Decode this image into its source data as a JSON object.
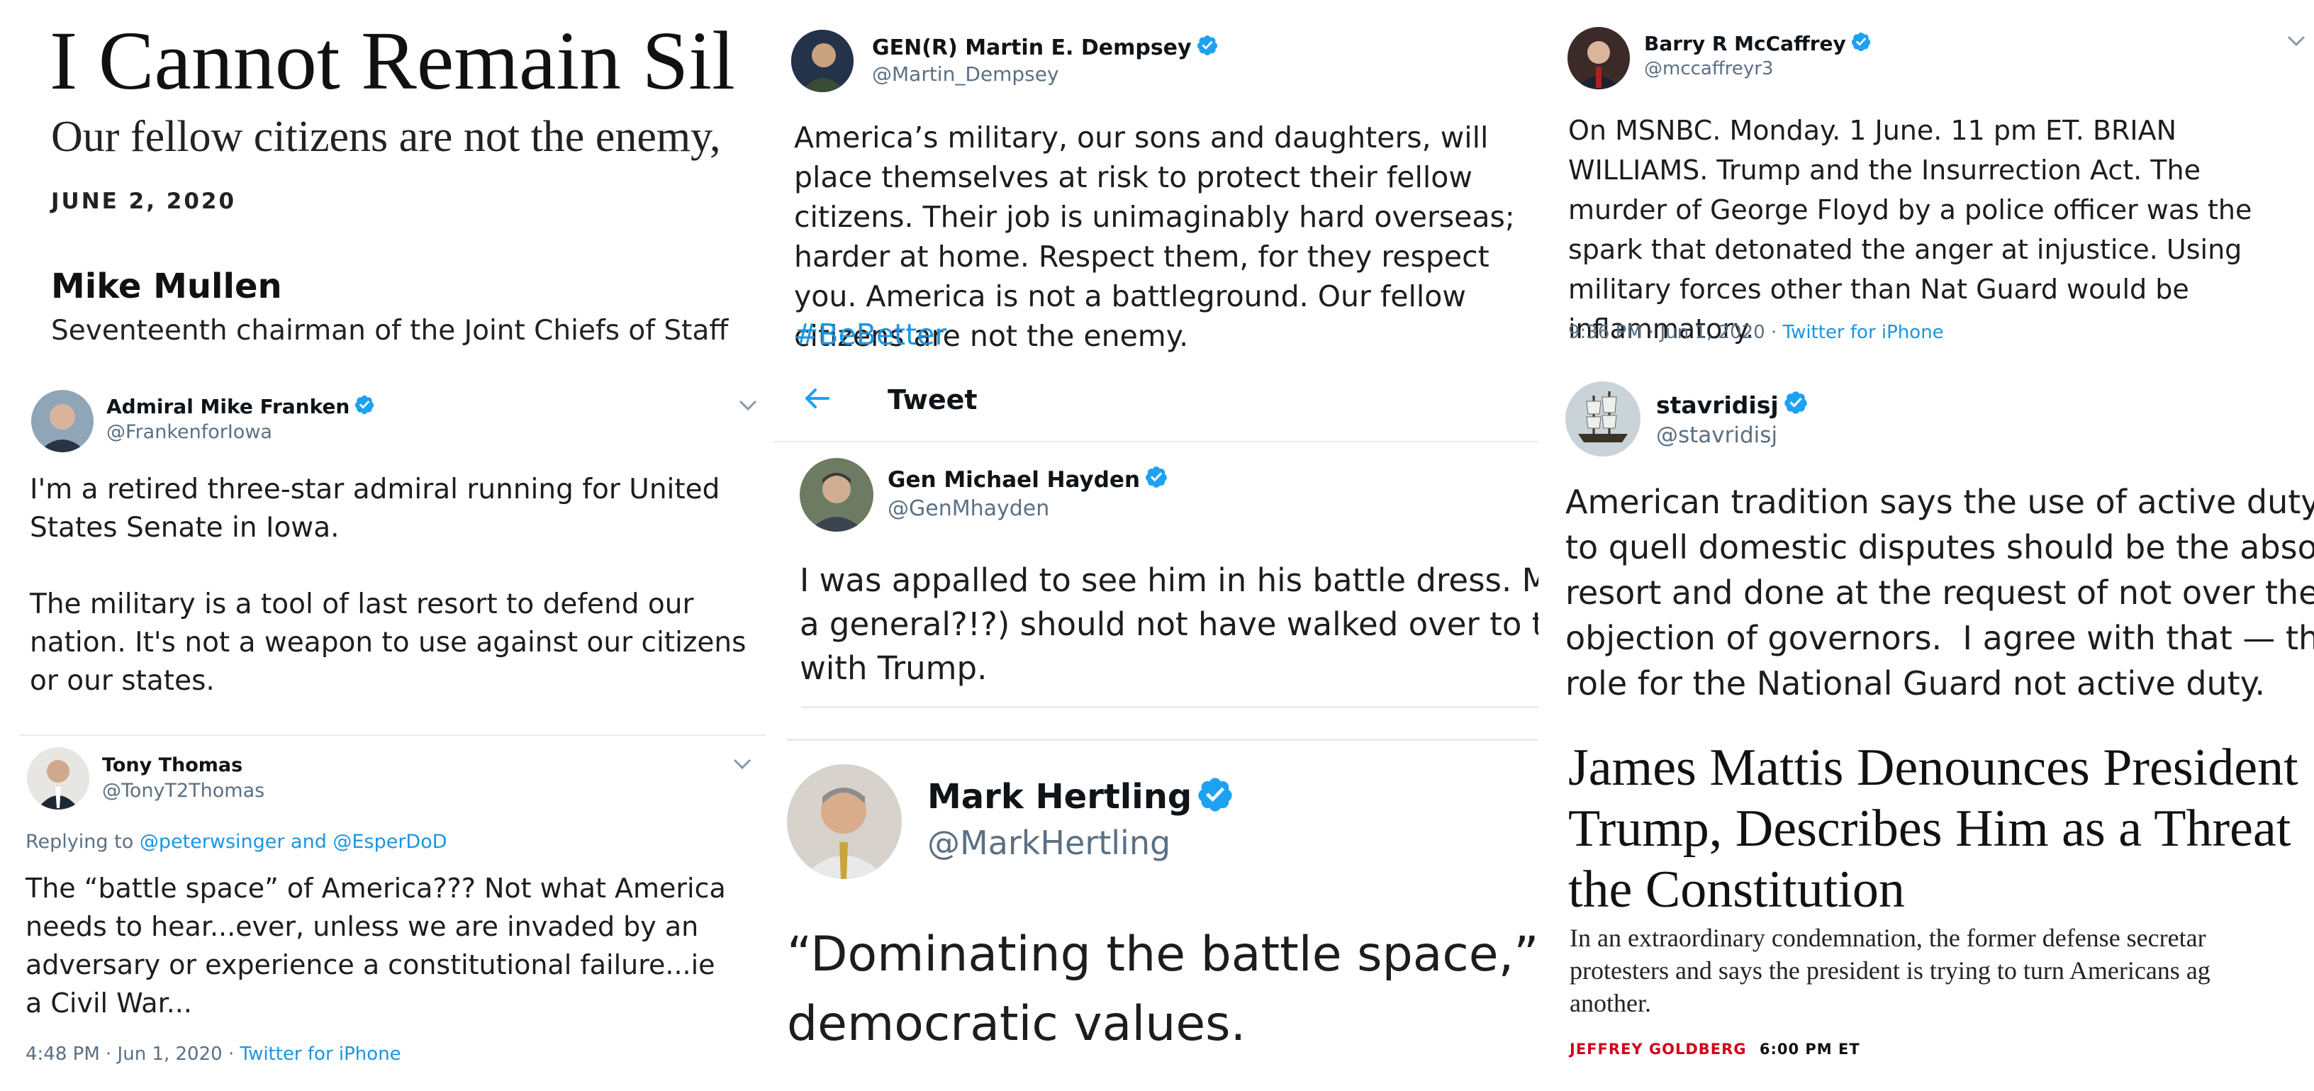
{
  "mullen": {
    "headline": "I Cannot Remain Sil",
    "subhead": "Our fellow citizens are not the enemy,",
    "date": "JUNE 2, 2020",
    "author": "Mike Mullen",
    "author_title": "Seventeenth chairman of the Joint Chiefs of Staff"
  },
  "dempsey": {
    "name": "GEN(R) Martin E. Dempsey",
    "handle": "@Martin_Dempsey",
    "text": "America’s military, our sons and daughters, will place themselves at risk to protect their fellow citizens. Their job is unimaginably hard overseas; harder at home. Respect them, for they respect you. America is not a battleground. Our fellow citizens are not the enemy.",
    "hashtag": "#BeBetter"
  },
  "mccaffrey": {
    "name": "Barry R McCaffrey",
    "handle": "@mccaffreyr3",
    "text": "On MSNBC. Monday. 1 June. 11 pm ET. BRIAN WILLIAMS. Trump and the Insurrection Act. The murder of George Floyd by a police officer was the spark that detonated the anger at injustice. Using military forces other than Nat Guard would be inflammatory.",
    "time": "9:36 PM · Jun 1, 2020 · ",
    "source": "Twitter for iPhone"
  },
  "franken": {
    "name": "Admiral Mike Franken",
    "handle": "@FrankenforIowa",
    "text1": "I'm a retired three-star admiral running for United States Senate in Iowa.",
    "text2": "The military is a tool of last resort to defend our nation. It's not a weapon to use against our citizens or our states."
  },
  "hayden": {
    "header_title": "Tweet",
    "name": "Gen Michael Hayden",
    "handle": "@GenMhayden",
    "text": "I was appalled to see him in his battle dress. Mi\na general?!?) should not have walked over to th\nwith Trump."
  },
  "stavridis": {
    "name": "stavridisj",
    "handle": "@stavridisj",
    "text": "American tradition says the use of active duty r\nto quell domestic disputes should be the absol\nresort and done at the request of not over the \nobjection of governors.  I agree with that — th\nrole for the National Guard not active duty."
  },
  "thomas": {
    "name": "Tony Thomas",
    "handle": "@TonyT2Thomas",
    "replying_prefix": "Replying to ",
    "replying_to": "@peterwsinger and @EsperDoD",
    "text": "The “battle space” of America???  Not what America needs to hear...ever, unless we are invaded by an adversary or experience a constitutional failure...ie a Civil War...",
    "time": "4:48 PM · Jun 1, 2020 · ",
    "source": "Twitter for iPhone"
  },
  "hertling": {
    "name": "Mark Hertling",
    "handle": "@MarkHertling",
    "text": "“Dominating the battle space,”\ndemocratic values."
  },
  "mattis": {
    "headline": "James Mattis Denounces President\nTrump, Describes Him as a Threat\nthe Constitution",
    "dek": "In an extraordinary condemnation, the former defense secretar\nprotesters and says the president is trying to turn Americans ag\nanother.",
    "byline": "JEFFREY GOLDBERG",
    "time": "6:00 PM ET"
  },
  "colors": {
    "link": "#1b95e0",
    "verified": "#1da1f2",
    "byline_red": "#d0021b",
    "muted": "#5b7083"
  },
  "icons": [
    "verified-badge-icon",
    "chevron-down-icon",
    "back-arrow-icon"
  ]
}
